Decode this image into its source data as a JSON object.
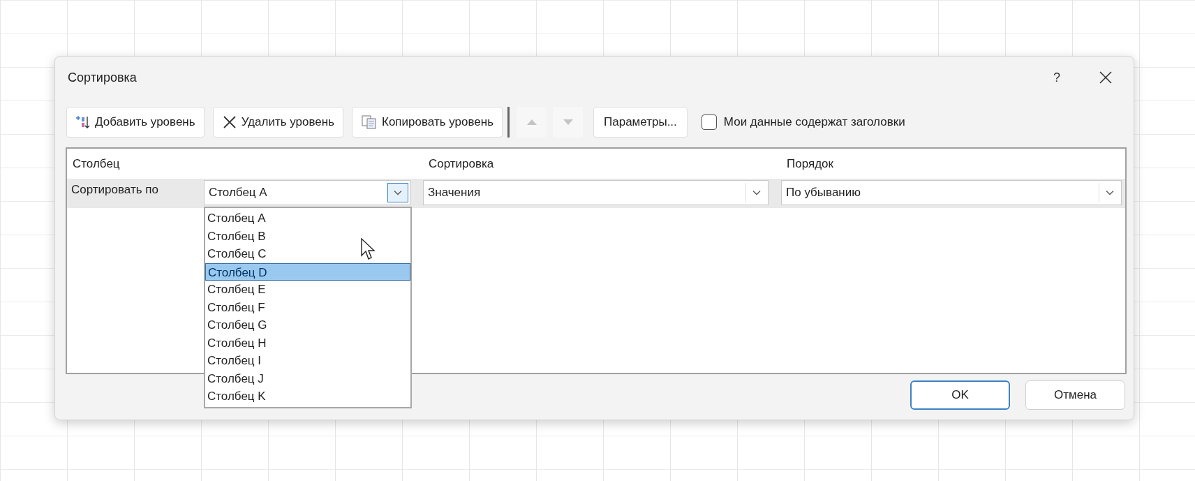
{
  "window": {
    "title": "Сортировка",
    "help": "?"
  },
  "toolbar": {
    "buttons": [
      {
        "label": "Добавить уровень",
        "kind": "add"
      },
      {
        "label": "Удалить уровень",
        "kind": "delete"
      },
      {
        "label": "Копировать уровень",
        "kind": "copy"
      }
    ],
    "move_up": {
      "disabled": true
    },
    "move_down": {
      "disabled": true
    },
    "options_button": "Параметры...",
    "headers_checkbox": {
      "label": "Мои данные содержат заголовки",
      "checked": false
    }
  },
  "table": {
    "columns": [
      "Столбец",
      "Сортировка",
      "Порядок"
    ],
    "rows": [
      {
        "label": "Сортировать по",
        "column": "Столбец A",
        "sort_on": "Значения",
        "order": "По убыванию",
        "expanded": true
      }
    ]
  },
  "dropdown": {
    "items": [
      {
        "label": "Столбец A",
        "selected": false
      },
      {
        "label": "Столбец B",
        "selected": false
      },
      {
        "label": "Столбец C",
        "selected": false
      },
      {
        "label": "Столбец D",
        "selected": true
      },
      {
        "label": "Столбец E",
        "selected": false
      },
      {
        "label": "Столбец F",
        "selected": false
      },
      {
        "label": "Столбец G",
        "selected": false
      },
      {
        "label": "Столбец H",
        "selected": false
      },
      {
        "label": "Столбец I",
        "selected": false
      },
      {
        "label": "Столбец J",
        "selected": false
      },
      {
        "label": "Столбец K",
        "selected": false
      }
    ]
  },
  "buttons": [
    "OK",
    "Отмена"
  ]
}
